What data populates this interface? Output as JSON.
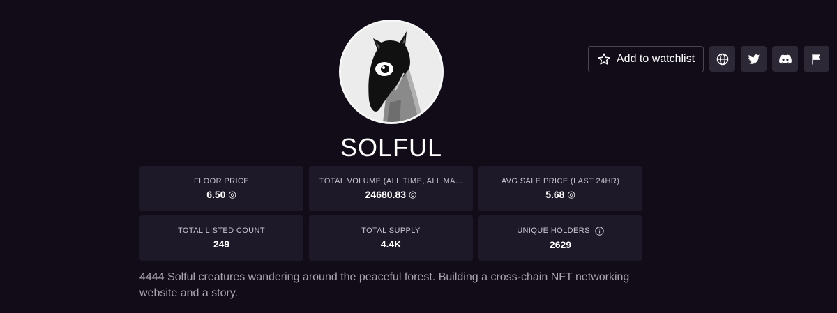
{
  "collection": {
    "name": "SOLFUL",
    "description": "4444 Solful creatures wandering around the peaceful forest. Building a cross-chain NFT networking website and a story.",
    "avatar_icon": "solful-creature-avatar"
  },
  "actions": {
    "watchlist_label": "Add to watchlist",
    "watchlist_icon": "star-icon",
    "links": [
      {
        "icon": "globe-icon"
      },
      {
        "icon": "twitter-icon"
      },
      {
        "icon": "discord-icon"
      },
      {
        "icon": "flag-icon"
      }
    ]
  },
  "stats": [
    {
      "label": "FLOOR PRICE",
      "value": "6.50",
      "currency_icon": "◎"
    },
    {
      "label": "TOTAL VOLUME (ALL TIME, ALL MA...",
      "value": "24680.83",
      "currency_icon": "◎"
    },
    {
      "label": "AVG SALE PRICE (LAST 24HR)",
      "value": "5.68",
      "currency_icon": "◎"
    },
    {
      "label": "TOTAL LISTED COUNT",
      "value": "249"
    },
    {
      "label": "TOTAL SUPPLY",
      "value": "4.4K"
    },
    {
      "label": "UNIQUE HOLDERS",
      "value": "2629",
      "info_icon": "info-icon"
    }
  ],
  "colors": {
    "background": "#120c18",
    "card": "#1d1928",
    "icon_button": "#2c2836",
    "muted_text": "#a9a4b1"
  }
}
